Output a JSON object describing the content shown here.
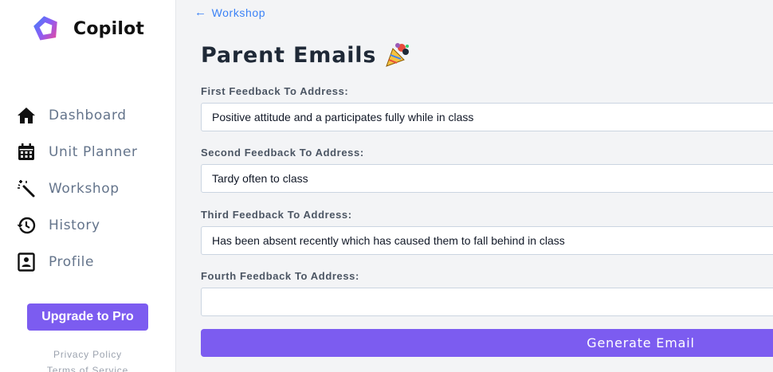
{
  "sidebar": {
    "brand": "Copilot",
    "nav": [
      {
        "label": "Dashboard",
        "icon": "home-icon"
      },
      {
        "label": "Unit Planner",
        "icon": "calendar-icon"
      },
      {
        "label": "Workshop",
        "icon": "magic-wand-icon"
      },
      {
        "label": "History",
        "icon": "history-icon"
      },
      {
        "label": "Profile",
        "icon": "profile-card-icon"
      }
    ],
    "upgrade_label": "Upgrade to Pro",
    "footer": {
      "privacy": "Privacy Policy",
      "terms": "Terms of Service"
    }
  },
  "main": {
    "back_label": "Workshop",
    "title": "Parent Emails",
    "fields": [
      {
        "label": "First Feedback To Address:",
        "value": "Positive attitude and a participates fully while in class"
      },
      {
        "label": "Second Feedback To Address:",
        "value": "Tardy often to class"
      },
      {
        "label": "Third Feedback To Address:",
        "value": "Has been absent recently which has caused them to fall behind in class"
      },
      {
        "label": "Fourth Feedback To Address:",
        "value": ""
      }
    ],
    "generate_label": "Generate Email"
  },
  "colors": {
    "accent": "#7c5cf0",
    "link": "#3b82f6",
    "nav_text": "#64748b"
  }
}
